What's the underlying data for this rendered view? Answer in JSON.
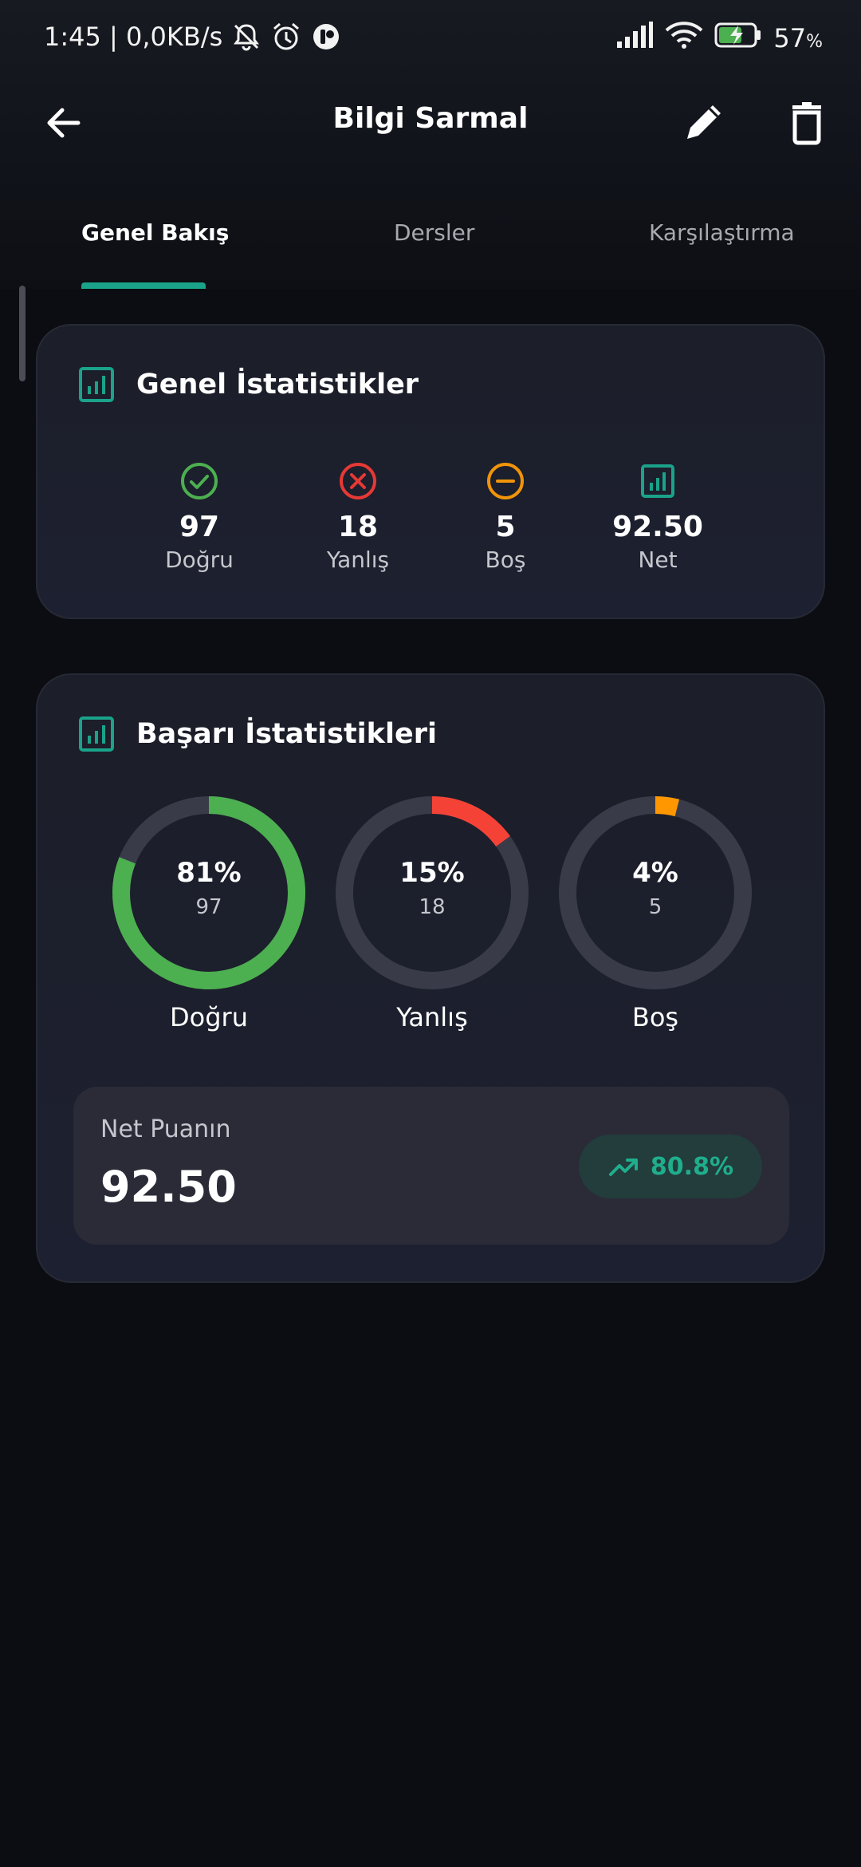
{
  "status_bar": {
    "time_speed": "1:45 | 0,0KB/s",
    "battery": "57",
    "battery_suffix": "%"
  },
  "app_bar": {
    "title": "Bilgi Sarmal",
    "back_icon": "arrow-left-icon",
    "edit_icon": "pencil-icon",
    "delete_icon": "trash-icon"
  },
  "tabs": [
    {
      "label": "Genel Bakış",
      "active": true
    },
    {
      "label": "Dersler",
      "active": false
    },
    {
      "label": "Karşılaştırma",
      "active": false
    }
  ],
  "general_stats": {
    "title": "Genel İstatistikler",
    "items": [
      {
        "value": "97",
        "label": "Doğru",
        "icon": "check-circle-icon",
        "color": "#4caf50"
      },
      {
        "value": "18",
        "label": "Yanlış",
        "icon": "x-circle-icon",
        "color": "#e53935"
      },
      {
        "value": "5",
        "label": "Boş",
        "icon": "minus-circle-icon",
        "color": "#f0940a"
      },
      {
        "value": "92.50",
        "label": "Net",
        "icon": "bar-chart-icon",
        "color": "#1aa38a"
      }
    ]
  },
  "success_stats": {
    "title": "Başarı İstatistikleri",
    "rings": [
      {
        "percent_text": "81%",
        "count": "97",
        "label": "Doğru",
        "fraction": 0.81,
        "color": "#4caf50"
      },
      {
        "percent_text": "15%",
        "count": "18",
        "label": "Yanlış",
        "fraction": 0.15,
        "color": "#f44336"
      },
      {
        "percent_text": "4%",
        "count": "5",
        "label": "Boş",
        "fraction": 0.04,
        "color": "#ff9800"
      }
    ],
    "net": {
      "label": "Net Puanın",
      "value": "92.50",
      "badge": "80.8%",
      "badge_icon": "trending-up-icon"
    }
  },
  "colors": {
    "accent": "#1aa38a",
    "ring_track": "#3a3b48",
    "background": "#0c0d12",
    "card": "#1d2030"
  }
}
